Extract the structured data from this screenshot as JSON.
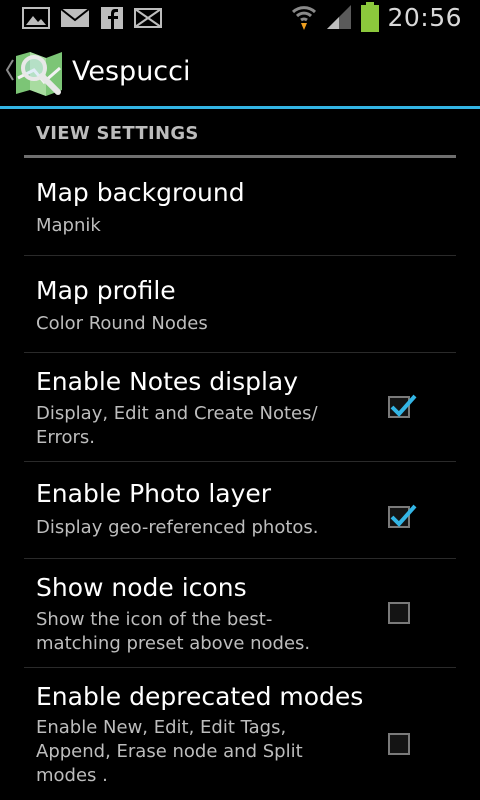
{
  "status_bar": {
    "time": "20:56",
    "icons": [
      "gallery-icon",
      "mail-icon",
      "facebook-icon",
      "message-icon",
      "wifi-icon",
      "signal-icon",
      "battery-icon"
    ]
  },
  "action_bar": {
    "title": "Vespucci",
    "accent_color": "#33b5e5"
  },
  "category": {
    "label": "VIEW SETTINGS"
  },
  "preferences": [
    {
      "title": "Map background",
      "summary": "Mapnik"
    },
    {
      "title": "Map profile",
      "summary": "Color Round Nodes"
    },
    {
      "title": "Enable Notes display",
      "summary": "Display, Edit and Create Notes/ Errors.",
      "checked": true
    },
    {
      "title": "Enable Photo layer",
      "summary": "Display geo-referenced photos.",
      "checked": true
    },
    {
      "title": "Show node icons",
      "summary": "Show the icon of the best-matching preset above nodes.",
      "checked": false
    },
    {
      "title": "Enable deprecated modes",
      "summary": "Enable New, Edit, Edit Tags, Append, Erase node and Split modes .",
      "checked": false
    }
  ]
}
